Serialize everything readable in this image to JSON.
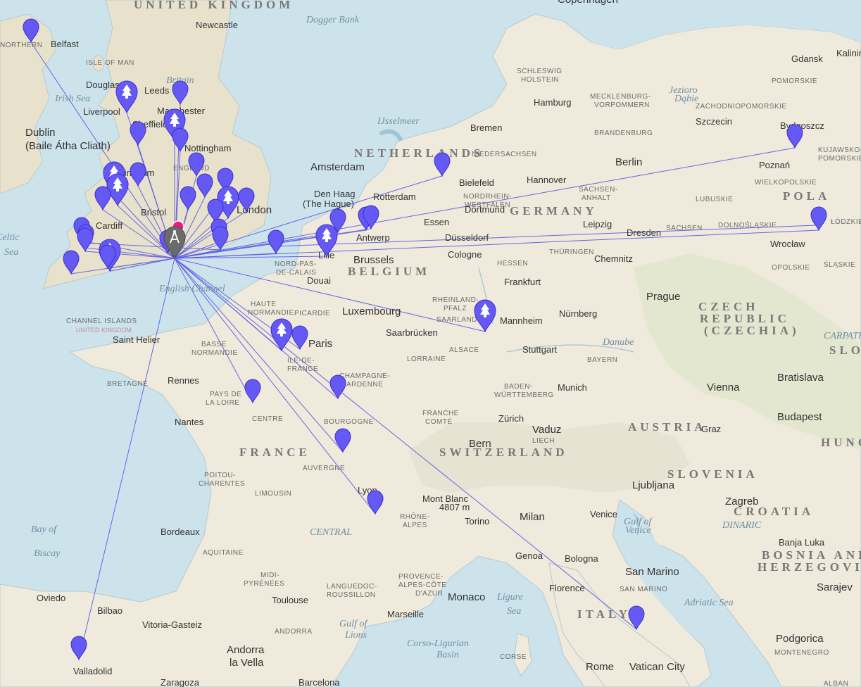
{
  "map": {
    "colors": {
      "sea": "#cde3ec",
      "land": "#efeadb",
      "land_green": "#dfe6cf",
      "uk": "#e8e2cc",
      "link": "#4f4fe8",
      "pin": "#6559f5",
      "hub": "#6b6b6b",
      "origin": "#f01a7a"
    },
    "labels": {
      "countries": [
        "UNITED KINGDOM",
        "NETHERLANDS",
        "BELGIUM",
        "GERMANY",
        "FRANCE",
        "CZECH REPUBLIC (CZECHIA)",
        "AUSTRIA",
        "SWITZERLAND",
        "SLOVENIA",
        "CROATIA",
        "BOSNIA AND HERZEGOVINA",
        "SAN MARINO",
        "ITALY",
        "HUNGARY",
        "SLOVAKIA",
        "POLAND",
        "ANDORRA",
        "MONTENEGRO",
        "ALBANIA",
        "LIECH",
        "ISLE OF MAN",
        "CHANNEL ISLANDS"
      ],
      "water": [
        "Dogger Bank",
        "Irish Sea",
        "Celtic Sea",
        "English Channel",
        "Bay of Biscay",
        "Gulf of Lions",
        "Ligure Sea",
        "Corso-Ligurian Basin",
        "Gulf of Venice",
        "Adriatic Sea",
        "IJsselmeer"
      ],
      "cities": [
        "Belfast",
        "Douglas",
        "Dublin (Baile Átha Cliath)",
        "Newcastle",
        "Leeds",
        "Manchester",
        "Liverpool",
        "Sheffield",
        "Nottingham",
        "Birmingham",
        "Cardiff",
        "Bristol",
        "London",
        "Amsterdam",
        "Den Haag (The Hague)",
        "Rotterdam",
        "Antwerp",
        "Brussels",
        "Lille",
        "Douai",
        "Luxembourg",
        "Paris",
        "Saint Helier",
        "Rennes",
        "Nantes",
        "Bordeaux",
        "Toulouse",
        "Lyon",
        "Marseille",
        "Monaco",
        "Berlin",
        "Hamburg",
        "Bremen",
        "Hannover",
        "Bielefeld",
        "Essen",
        "Dortmund",
        "Düsseldorf",
        "Cologne",
        "Leipzig",
        "Dresden",
        "Chemnitz",
        "Frankfurt",
        "Nürnberg",
        "Mannheim",
        "Saarbrücken",
        "Stuttgart",
        "Munich",
        "Prague",
        "Vienna",
        "Bratislava",
        "Budapest",
        "Zürich",
        "Bern",
        "Vaduz",
        "Milan",
        "Torino",
        "Genoa",
        "Bologna",
        "Florence",
        "Venice",
        "Ljubljana",
        "Zagreb",
        "Banja Luka",
        "Sarajevo",
        "Podgorica",
        "Rome",
        "Vatican City",
        "San Marino",
        "Andorra la Vella",
        "Oviedo",
        "Bilbao",
        "Vitoria-Gasteiz",
        "Valladolid",
        "Zaragoza",
        "Barcelona",
        "Gdansk",
        "Szczecin",
        "Bydgoszcz",
        "Poznań",
        "Wrocław",
        "Copenhagen",
        "Kalining",
        "Graz",
        "Mont Blanc 4807 m",
        "Prague"
      ],
      "regions": [
        "SCHLESWIG HOLSTEIN",
        "MECKLENBURG-VORPOMMERN",
        "BRANDENBURG",
        "NIEDERSACHSEN",
        "NORDRHEIN-WESTFALEN",
        "SACHSEN-ANHALT",
        "THÜRINGEN",
        "SACHSEN",
        "HESSEN",
        "RHEINLAND-PFALZ",
        "SAARLAND",
        "BADEN-WÜRTTEMBERG",
        "BAYERN",
        "HAUTE NORMANDIE",
        "BASSE NORMANDIE",
        "PICARDIE",
        "NORD-PAS-DE-CALAIS",
        "ILE-DE-FRANCE",
        "CHAMPAGNE-ARDENNE",
        "LORRAINE",
        "ALSACE",
        "BRETAGNE",
        "PAYS DE LA LOIRE",
        "CENTRE",
        "BOURGOGNE",
        "FRANCHE COMTÉ",
        "POITOU-CHARENTES",
        "LIMOUSIN",
        "AUVERGNE",
        "RHÔNE-ALPES",
        "AQUITAINE",
        "MIDI-PYRÉNÉES",
        "LANGUEDOC-ROUSSILLON",
        "PROVENCE-ALPES-CÔTE D'AZUR",
        "POMORSKIE",
        "ZACHODNIOPOMORSKIE",
        "KUJAWSKO-POMORSKIE",
        "WIELKOPOLSKIE",
        "LUBUSKIE",
        "DOLNOŚLĄSKIE",
        "OPOLSKIE",
        "ŚLĄSKIE",
        "ŁÓDZKIE",
        "CARPATHI",
        "CENTRAL",
        "DINARIC",
        "CORSE",
        "NORTHERN"
      ]
    },
    "hub": {
      "name": "hub",
      "icon": "radio-tower-icon"
    },
    "origin_marker": {
      "name": "origin",
      "icon": "dot-icon"
    },
    "pins": [
      {
        "id": "p1",
        "icon": "pin-icon"
      },
      {
        "id": "p2",
        "icon": "tree-icon"
      },
      {
        "id": "p3",
        "icon": "pin-icon"
      },
      {
        "id": "p4",
        "icon": "pin-icon"
      },
      {
        "id": "p5",
        "icon": "tree-icon"
      },
      {
        "id": "p6",
        "icon": "pin-icon"
      },
      {
        "id": "p7",
        "icon": "pin-icon"
      },
      {
        "id": "p8",
        "icon": "pin-icon"
      },
      {
        "id": "p9",
        "icon": "tree-icon"
      },
      {
        "id": "p10",
        "icon": "pin-icon"
      },
      {
        "id": "p11",
        "icon": "pin-icon"
      },
      {
        "id": "p12",
        "icon": "tree-icon"
      },
      {
        "id": "p13",
        "icon": "pin-icon"
      },
      {
        "id": "p14",
        "icon": "pin-icon"
      },
      {
        "id": "p15",
        "icon": "tree-icon"
      },
      {
        "id": "p16",
        "icon": "pin-icon"
      },
      {
        "id": "p17",
        "icon": "pin-icon"
      },
      {
        "id": "p18",
        "icon": "pin-icon"
      },
      {
        "id": "p19",
        "icon": "pin-icon"
      },
      {
        "id": "p20",
        "icon": "pin-icon"
      },
      {
        "id": "p21",
        "icon": "pin-icon"
      },
      {
        "id": "p22",
        "icon": "pin-icon"
      },
      {
        "id": "p23",
        "icon": "pin-icon"
      },
      {
        "id": "p24",
        "icon": "tree-icon"
      },
      {
        "id": "p25",
        "icon": "pin-icon"
      },
      {
        "id": "p26",
        "icon": "pin-icon"
      },
      {
        "id": "p27",
        "icon": "pin-icon"
      },
      {
        "id": "p28",
        "icon": "tree-icon"
      },
      {
        "id": "p29",
        "icon": "pin-icon"
      },
      {
        "id": "p30",
        "icon": "pin-icon"
      },
      {
        "id": "p31",
        "icon": "pin-icon"
      },
      {
        "id": "p32",
        "icon": "pin-icon"
      },
      {
        "id": "p33",
        "icon": "pin-icon"
      },
      {
        "id": "p34",
        "icon": "pin-icon"
      },
      {
        "id": "p35",
        "icon": "pin-icon"
      },
      {
        "id": "p36",
        "icon": "tree-icon"
      },
      {
        "id": "p37",
        "icon": "pin-icon"
      },
      {
        "id": "p38",
        "icon": "pin-icon"
      },
      {
        "id": "p39",
        "icon": "pin-icon"
      },
      {
        "id": "p40",
        "icon": "pin-icon"
      },
      {
        "id": "p41",
        "icon": "pin-icon"
      },
      {
        "id": "p42",
        "icon": "pin-icon"
      }
    ]
  }
}
